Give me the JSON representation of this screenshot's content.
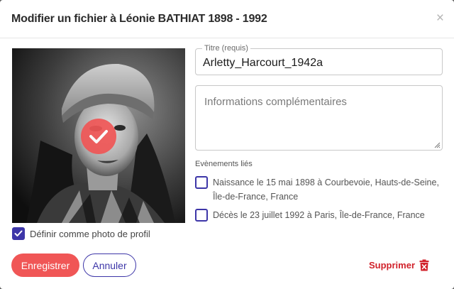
{
  "dialog": {
    "title": "Modifier un fichier à Léonie BATHIAT 1898 - 1992",
    "close_label": "×"
  },
  "photo": {
    "selected": true,
    "profile_checkbox_checked": true,
    "profile_label": "Définir comme photo de profil"
  },
  "form": {
    "title_label": "Titre (requis)",
    "title_value": "Arletty_Harcourt_1942a",
    "info_placeholder": "Informations complémentaires",
    "events_label": "Evènements liés",
    "events": [
      {
        "label": "Naissance le 15 mai 1898 à Courbevoie, Hauts-de-Seine, Île-de-France, France",
        "checked": false
      },
      {
        "label": "Décès le 23 juillet 1992 à Paris, Île-de-France, France",
        "checked": false
      }
    ]
  },
  "footer": {
    "save_label": "Enregistrer",
    "cancel_label": "Annuler",
    "delete_label": "Supprimer"
  },
  "colors": {
    "accent_red": "#f05656",
    "accent_purple": "#3d36a8",
    "delete_red": "#d1222b"
  }
}
